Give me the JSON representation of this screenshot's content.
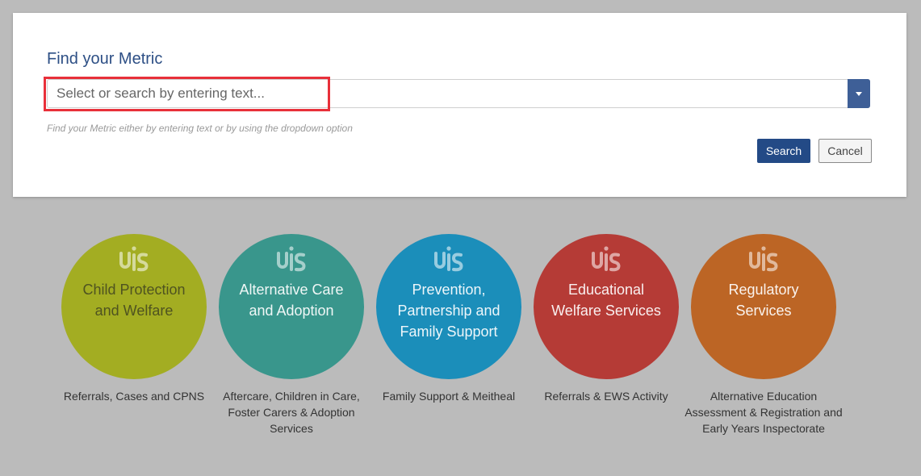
{
  "search": {
    "title": "Find your Metric",
    "placeholder": "Select or search by entering text...",
    "hint": "Find your Metric either by entering text or by using the dropdown option",
    "search_label": "Search",
    "cancel_label": "Cancel"
  },
  "colors": {
    "title": "#2d4f85",
    "search_button": "#234a86",
    "dropdown_button": "#3e5f97",
    "highlight": "#e8303a"
  },
  "categories": [
    {
      "title": "Child Protection and Welfare",
      "description": "Referrals, Cases and CPNS",
      "color": "#a3ad22",
      "logo_icon": "tusla-logo-icon"
    },
    {
      "title": "Alternative Care and Adoption",
      "description": "Aftercare, Children in Care, Foster Carers & Adoption Services",
      "color": "#39968c",
      "logo_icon": "tusla-logo-icon"
    },
    {
      "title": "Prevention, Partnership and Family Support",
      "description": "Family Support & Meitheal",
      "color": "#1b8eba",
      "logo_icon": "tusla-logo-icon"
    },
    {
      "title": "Educational Welfare Services",
      "description": "Referrals & EWS Activity",
      "color": "#b53b36",
      "logo_icon": "tusla-logo-icon"
    },
    {
      "title": "Regulatory Services",
      "description": "Alternative Education Assessment & Registration and Early Years Inspectorate",
      "color": "#bc6525",
      "logo_icon": "tusla-logo-icon"
    }
  ]
}
